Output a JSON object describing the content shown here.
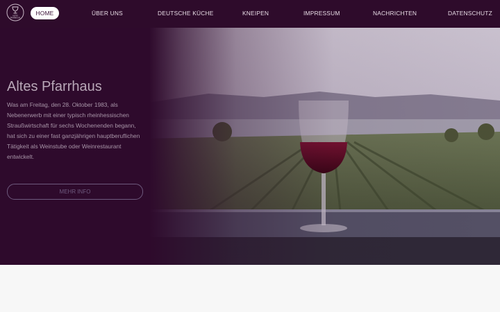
{
  "brand": {
    "logo_text": "ALTES PFARRHAUS",
    "logo_icon": "wine-glass-logo"
  },
  "nav": {
    "items": [
      {
        "label": "HOME",
        "active": true
      },
      {
        "label": "ÜBER UNS"
      },
      {
        "label": "DEUTSCHE KÜCHE"
      },
      {
        "label": "KNEIPEN"
      },
      {
        "label": "IMPRESSUM"
      },
      {
        "label": "NACHRICHTEN"
      },
      {
        "label": "DATENSCHUTZ"
      }
    ]
  },
  "hero": {
    "title": "Altes Pfarrhaus",
    "text": "Was am Freitag, den 28. Oktober 1983, als Nebenerwerb mit einer typisch rheinhessischen Straußwirtschaft für sechs Wochenenden begann, hat sich zu einer fast ganzjährigen hauptberuflichen Tätigkeit als Weinstube oder Weinrestaurant entwickelt.",
    "button_label": "MEHR INFO",
    "image": "wine-glass-vineyard-photo"
  },
  "colors": {
    "header_bg": "#2e0b2b",
    "hero_bg": "#2f0a2d",
    "accent_button": "#6e5a7e",
    "page_bg": "#f7f7f7"
  }
}
